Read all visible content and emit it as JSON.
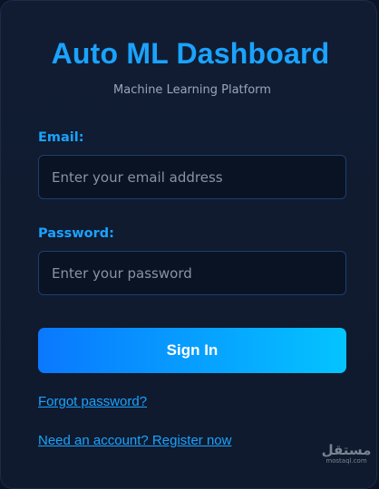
{
  "header": {
    "title": "Auto ML Dashboard",
    "subtitle": "Machine Learning Platform"
  },
  "form": {
    "email_label": "Email:",
    "email_placeholder": "Enter your email address",
    "email_value": "",
    "password_label": "Password:",
    "password_placeholder": "Enter your password",
    "password_value": "",
    "sign_in_label": "Sign In"
  },
  "links": {
    "forgot": "Forgot password?",
    "register": "Need an account? Register now"
  },
  "watermark": {
    "logo": "مستقل",
    "text": "mostaql.com"
  },
  "colors": {
    "accent": "#1aa3ff",
    "button_start": "#0a78ff",
    "button_end": "#04c4ff",
    "background": "#0f1a2e"
  }
}
